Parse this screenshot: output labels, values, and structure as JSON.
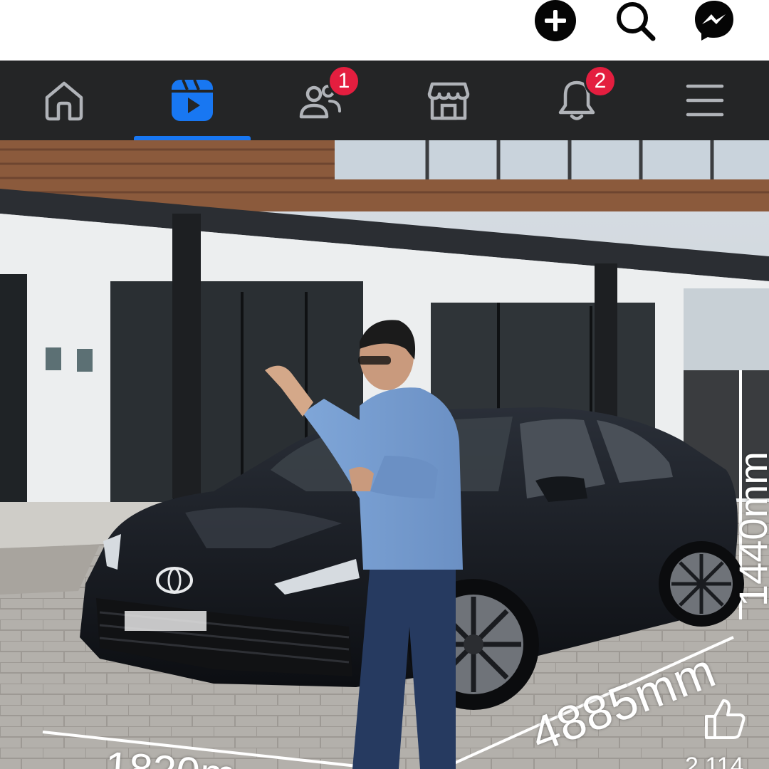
{
  "header": {
    "icons": [
      "plus-icon",
      "search-icon",
      "messenger-icon"
    ]
  },
  "tabs": [
    {
      "id": "home",
      "icon": "home-icon",
      "active": false
    },
    {
      "id": "video",
      "icon": "video-icon",
      "active": true
    },
    {
      "id": "friends",
      "icon": "friends-icon",
      "active": false,
      "badge": "1"
    },
    {
      "id": "marketplace",
      "icon": "marketplace-icon",
      "active": false
    },
    {
      "id": "notifications",
      "icon": "bell-icon",
      "active": false,
      "badge": "2"
    },
    {
      "id": "menu",
      "icon": "menu-icon",
      "active": false
    }
  ],
  "video": {
    "dimension_length": "4885mm",
    "dimension_width": "1820m",
    "dimension_height": "1440mm",
    "like_count": "2,114"
  },
  "colors": {
    "tabbar_bg": "#242526",
    "accent": "#1877f2",
    "badge": "#e41e3f"
  }
}
